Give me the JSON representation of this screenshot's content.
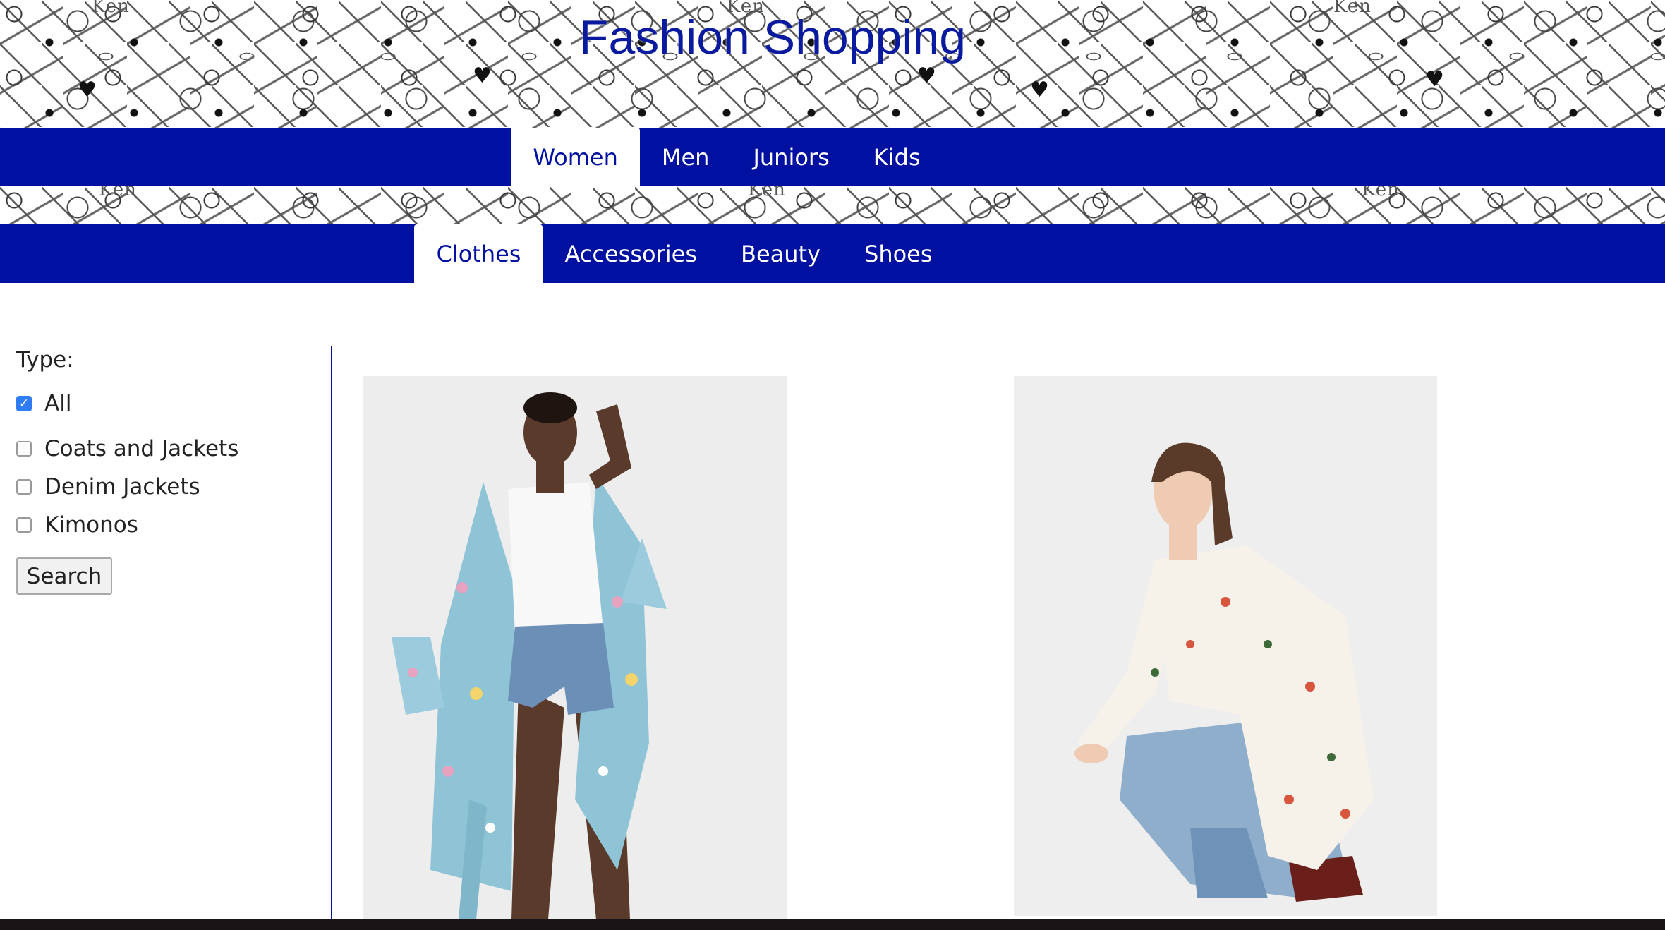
{
  "site": {
    "title": "Fashion Shopping"
  },
  "main_nav": {
    "items": [
      {
        "label": "Women",
        "active": true
      },
      {
        "label": "Men",
        "active": false
      },
      {
        "label": "Juniors",
        "active": false
      },
      {
        "label": "Kids",
        "active": false
      }
    ]
  },
  "sub_nav": {
    "items": [
      {
        "label": "Clothes",
        "active": true
      },
      {
        "label": "Accessories",
        "active": false
      },
      {
        "label": "Beauty",
        "active": false
      },
      {
        "label": "Shoes",
        "active": false
      }
    ]
  },
  "filters": {
    "type_label": "Type:",
    "options": [
      {
        "label": "All",
        "checked": true
      },
      {
        "label": "Coats and Jackets",
        "checked": false
      },
      {
        "label": "Denim Jackets",
        "checked": false
      },
      {
        "label": "Kimonos",
        "checked": false
      }
    ],
    "search_label": "Search"
  },
  "colors": {
    "nav_background": "#0010a0",
    "title": "#0a1a9e",
    "checkbox_checked": "#2f7df6"
  },
  "icons": {
    "checkbox_checked": "checkmark-icon"
  }
}
